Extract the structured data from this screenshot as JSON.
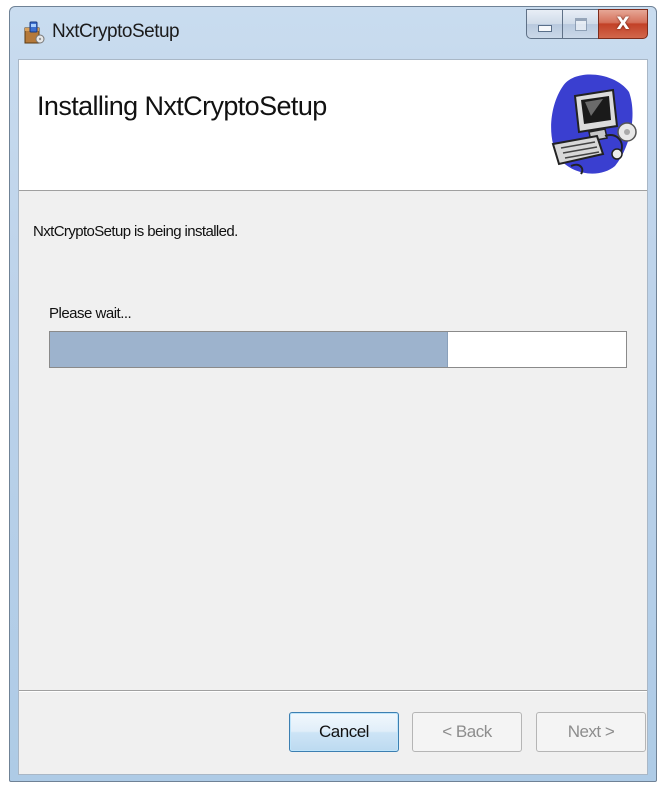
{
  "window": {
    "title": "NxtCryptoSetup",
    "app_icon": "installer-box-icon",
    "caption_buttons": {
      "minimize_icon": "minimize-icon",
      "maximize_icon": "maximize-icon",
      "close_glyph": "X"
    }
  },
  "banner": {
    "title": "Installing NxtCryptoSetup",
    "graphic_icon": "computer-setup-graphic"
  },
  "body": {
    "status": "NxtCryptoSetup is being installed.",
    "wait_label": "Please wait...",
    "progress_percent": 69
  },
  "buttons": {
    "cancel": "Cancel",
    "back": "< Back",
    "next": "Next >"
  },
  "colors": {
    "progress_fill": "#9db3cd",
    "close_button": "#c24127",
    "titlebar": "#bcd2ea"
  }
}
